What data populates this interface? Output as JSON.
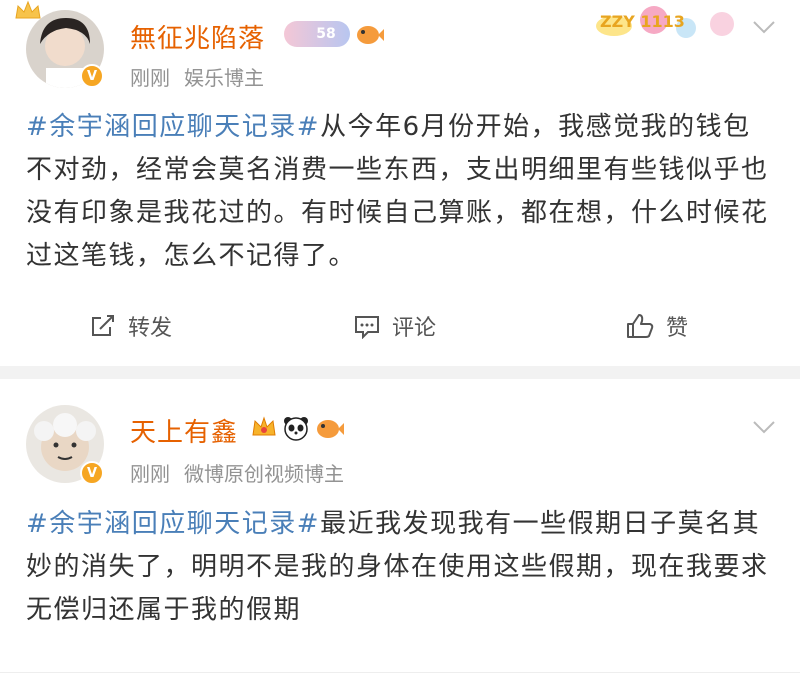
{
  "posts": [
    {
      "username": "無征兆陷落",
      "time": "刚刚",
      "source": "娱乐博主",
      "level_badge": "58",
      "decoration_text": "ZZY 1113",
      "hashtag": "#余宇涵回应聊天记录#",
      "body": "从今年6月份开始，我感觉我的钱包不对劲，经常会莫名消费一些东西，支出明细里有些钱似乎也没有印象是我花过的。有时候自己算账，都在想，什么时候花过这笔钱，怎么不记得了。",
      "actions": {
        "repost": "转发",
        "comment": "评论",
        "like": "赞"
      }
    },
    {
      "username": "天上有鑫",
      "time": "刚刚",
      "source": "微博原创视频博主",
      "hashtag": "#余宇涵回应聊天记录#",
      "body": "最近我发现我有一些假期日子莫名其妙的消失了，明明不是我的身体在使用这些假期，现在我要求无偿归还属于我的假期"
    }
  ],
  "colors": {
    "username": "#e66100",
    "hashtag": "#4a7fb8",
    "meta": "#939393",
    "verified": "#f6a623"
  },
  "icons": [
    "crown-icon",
    "verified-badge-icon",
    "level-badge-icon",
    "pufferfish-icon",
    "chevron-down-icon",
    "repost-icon",
    "comment-icon",
    "like-icon",
    "panda-icon",
    "vip-crown-icon"
  ]
}
